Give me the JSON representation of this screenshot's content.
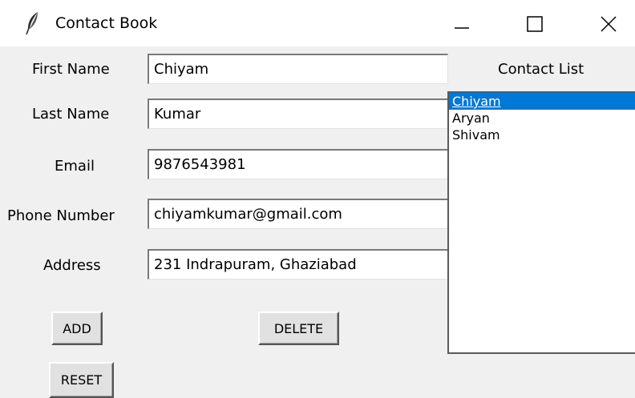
{
  "window": {
    "title": "Contact Book",
    "controls": {
      "minimize": "minimize-icon",
      "maximize": "maximize-icon",
      "close": "close-icon"
    }
  },
  "form": {
    "fields": [
      {
        "label": "First Name",
        "value": "Chiyam"
      },
      {
        "label": "Last Name",
        "value": "Kumar"
      },
      {
        "label": "Email",
        "value": "9876543981"
      },
      {
        "label": "Phone Number",
        "value": "chiyamkumar@gmail.com"
      },
      {
        "label": "Address",
        "value": "231 Indrapuram, Ghaziabad"
      }
    ]
  },
  "buttons": {
    "add": "ADD",
    "delete": "DELETE",
    "reset": "RESET"
  },
  "contact_list": {
    "title": "Contact List",
    "items": [
      "Chiyam",
      "Aryan",
      "Shivam"
    ],
    "selected_index": 0
  },
  "colors": {
    "selection": "#0078d7",
    "client_background": "#f0f0f0"
  }
}
